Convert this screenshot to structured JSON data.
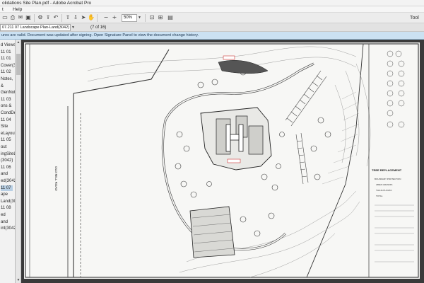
{
  "window": {
    "title": "olidations Site Plan.pdf - Adobe Acrobat Pro"
  },
  "menu": {
    "items": [
      "t",
      "Help"
    ]
  },
  "toolbar": {
    "zoom": "50%",
    "tools_label": "Tool",
    "icons": [
      "open-icon",
      "print-icon",
      "email-icon",
      "save-icon",
      "settings-icon",
      "upload-icon",
      "back-icon",
      "page-up-icon",
      "page-down-icon",
      "select-icon",
      "hand-icon",
      "zoom-out-icon",
      "zoom-in-icon",
      "fit-page-icon",
      "fit-width-icon",
      "comment-icon"
    ]
  },
  "navigation": {
    "page_label": "07.211 07 Landscape Plan-Land(3042)",
    "page_count": "(7 of 16)"
  },
  "signature_bar": {
    "message": "ures are valid. Document was updated after signing. Open Signature Panel to view the document change history."
  },
  "bookmarks": [
    "d Views",
    "11 01",
    "11 01",
    "Cover(30",
    "11 02",
    "Notes,",
    "&",
    "GenNot",
    "11 03",
    "ons &",
    "CondDe",
    "11 04",
    "Site",
    "eLayout(",
    "11 05",
    "out",
    "ingSiteLa",
    "(3042)",
    "11 06",
    "and",
    "ed(3042)",
    "11 07",
    "ape",
    "Land(3042)",
    "11 08",
    "ed",
    "and",
    "int(3042)"
  ],
  "bookmark_selected_index": 21,
  "drawing": {
    "road_label": "OLD MILL ROAD",
    "schedule_title": "TREE REPLACEMENT",
    "notes": [
      "BOUNDARY PROTECTION",
      "ABIES GRANDIS",
      "THUJA PLICATA",
      "TOTAL"
    ]
  }
}
